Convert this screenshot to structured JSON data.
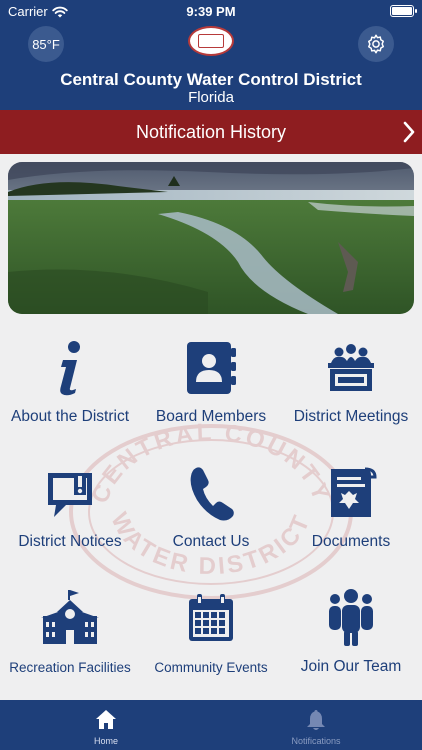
{
  "status_bar": {
    "carrier": "Carrier",
    "time": "9:39 PM"
  },
  "header": {
    "temperature": "85°F",
    "title": "Central County Water Control District",
    "subtitle": "Florida",
    "logo_text": "CENTRAL COUNTY WATER DISTRICT"
  },
  "notification_bar": {
    "label": "Notification History"
  },
  "watermark": {
    "top_text": "CENTRAL COUNTY",
    "bottom_text": "WATER DISTRICT"
  },
  "tiles": [
    {
      "label": "About the District",
      "icon": "info-icon"
    },
    {
      "label": "Board Members",
      "icon": "address-book-icon"
    },
    {
      "label": "District Meetings",
      "icon": "meeting-icon"
    },
    {
      "label": "District Notices",
      "icon": "notice-icon"
    },
    {
      "label": "Contact Us",
      "icon": "phone-icon"
    },
    {
      "label": "Documents",
      "icon": "document-icon"
    },
    {
      "label": "Recreation Facilities",
      "icon": "schoolhouse-icon"
    },
    {
      "label": "Community Events",
      "icon": "calendar-icon"
    },
    {
      "label": "Join Our Team",
      "icon": "team-icon"
    }
  ],
  "tabbar": {
    "tabs": [
      {
        "label": "Home",
        "icon": "home-icon"
      },
      {
        "label": "Notifications",
        "icon": "bell-icon"
      }
    ]
  },
  "colors": {
    "primary": "#1e3f7a",
    "accent": "#8e1d20",
    "background": "#efeff0"
  }
}
